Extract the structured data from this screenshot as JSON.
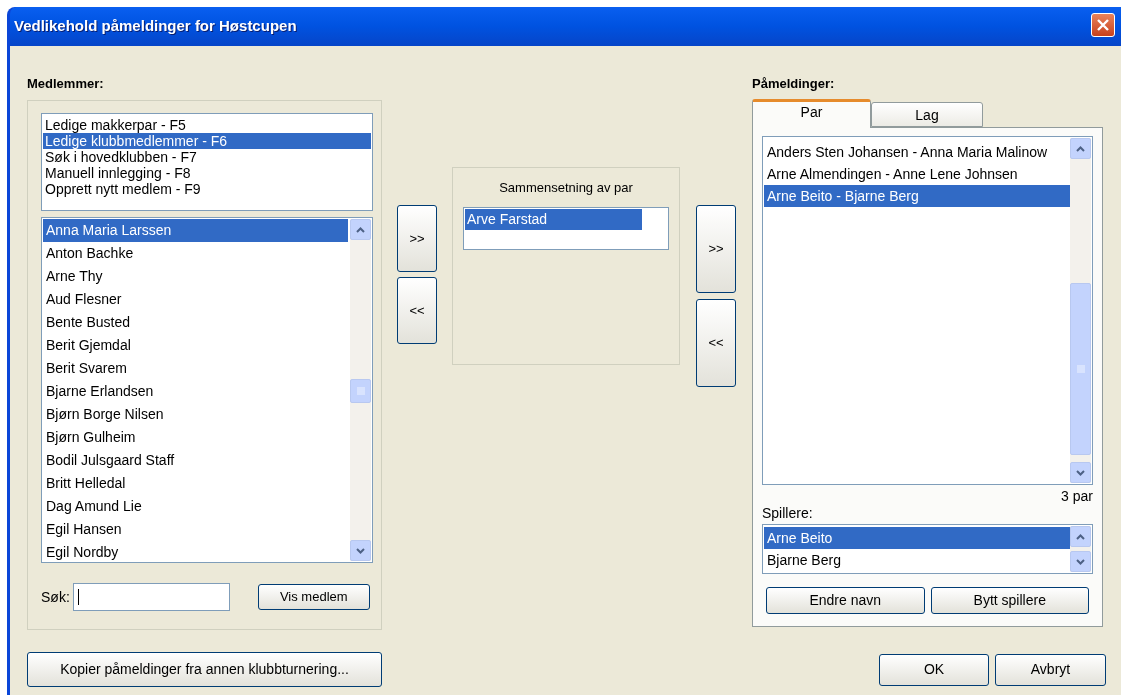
{
  "window": {
    "title": "Vedlikehold påmeldinger for Høstcupen"
  },
  "members": {
    "label": "Medlemmer:",
    "sources": [
      {
        "label": "Ledige makkerpar - F5",
        "selected": false
      },
      {
        "label": "Ledige klubbmedlemmer - F6",
        "selected": true
      },
      {
        "label": "Søk i hovedklubben - F7",
        "selected": false
      },
      {
        "label": "Manuell innlegging - F8",
        "selected": false
      },
      {
        "label": "Opprett nytt medlem - F9",
        "selected": false
      }
    ],
    "list": [
      {
        "name": "Anna Maria Larssen",
        "selected": true
      },
      {
        "name": "Anton Bachke",
        "selected": false
      },
      {
        "name": "Arne Thy",
        "selected": false
      },
      {
        "name": "Aud Flesner",
        "selected": false
      },
      {
        "name": "Bente Busted",
        "selected": false
      },
      {
        "name": "Berit Gjemdal",
        "selected": false
      },
      {
        "name": "Berit Svarem",
        "selected": false
      },
      {
        "name": "Bjarne Erlandsen",
        "selected": false
      },
      {
        "name": "Bjørn Borge Nilsen",
        "selected": false
      },
      {
        "name": "Bjørn Gulheim",
        "selected": false
      },
      {
        "name": "Bodil Julsgaard Staff",
        "selected": false
      },
      {
        "name": "Britt Helledal",
        "selected": false
      },
      {
        "name": "Dag Amund Lie",
        "selected": false
      },
      {
        "name": "Egil Hansen",
        "selected": false
      },
      {
        "name": "Egil Nordby",
        "selected": false
      }
    ],
    "search_label": "Søk:",
    "show_button": "Vis medlem"
  },
  "transfer_buttons_left": [
    ">>",
    "<<"
  ],
  "pair_builder": {
    "title": "Sammensetning av par",
    "items": [
      {
        "name": "Arve Farstad",
        "selected": true
      }
    ]
  },
  "transfer_buttons_right": [
    ">>",
    "<<"
  ],
  "registrations": {
    "label": "Påmeldinger:",
    "tabs": [
      {
        "label": "Par",
        "selected": true
      },
      {
        "label": "Lag",
        "selected": false
      }
    ],
    "pairs": [
      {
        "name": "Anders Sten Johansen - Anna Maria Malinow",
        "selected": false
      },
      {
        "name": "Arne Almendingen - Anne Lene Johnsen",
        "selected": false
      },
      {
        "name": "Arne Beito - Bjarne Berg",
        "selected": true
      }
    ],
    "count": "3 par",
    "players_label": "Spillere:",
    "players": [
      {
        "name": "Arne Beito",
        "selected": true
      },
      {
        "name": "Bjarne Berg",
        "selected": false
      }
    ],
    "buttons": [
      "Endre navn",
      "Bytt spillere"
    ]
  },
  "copy_button": "Kopier påmeldinger fra annen klubbturnering...",
  "dialog_buttons": [
    "OK",
    "Avbryt"
  ]
}
